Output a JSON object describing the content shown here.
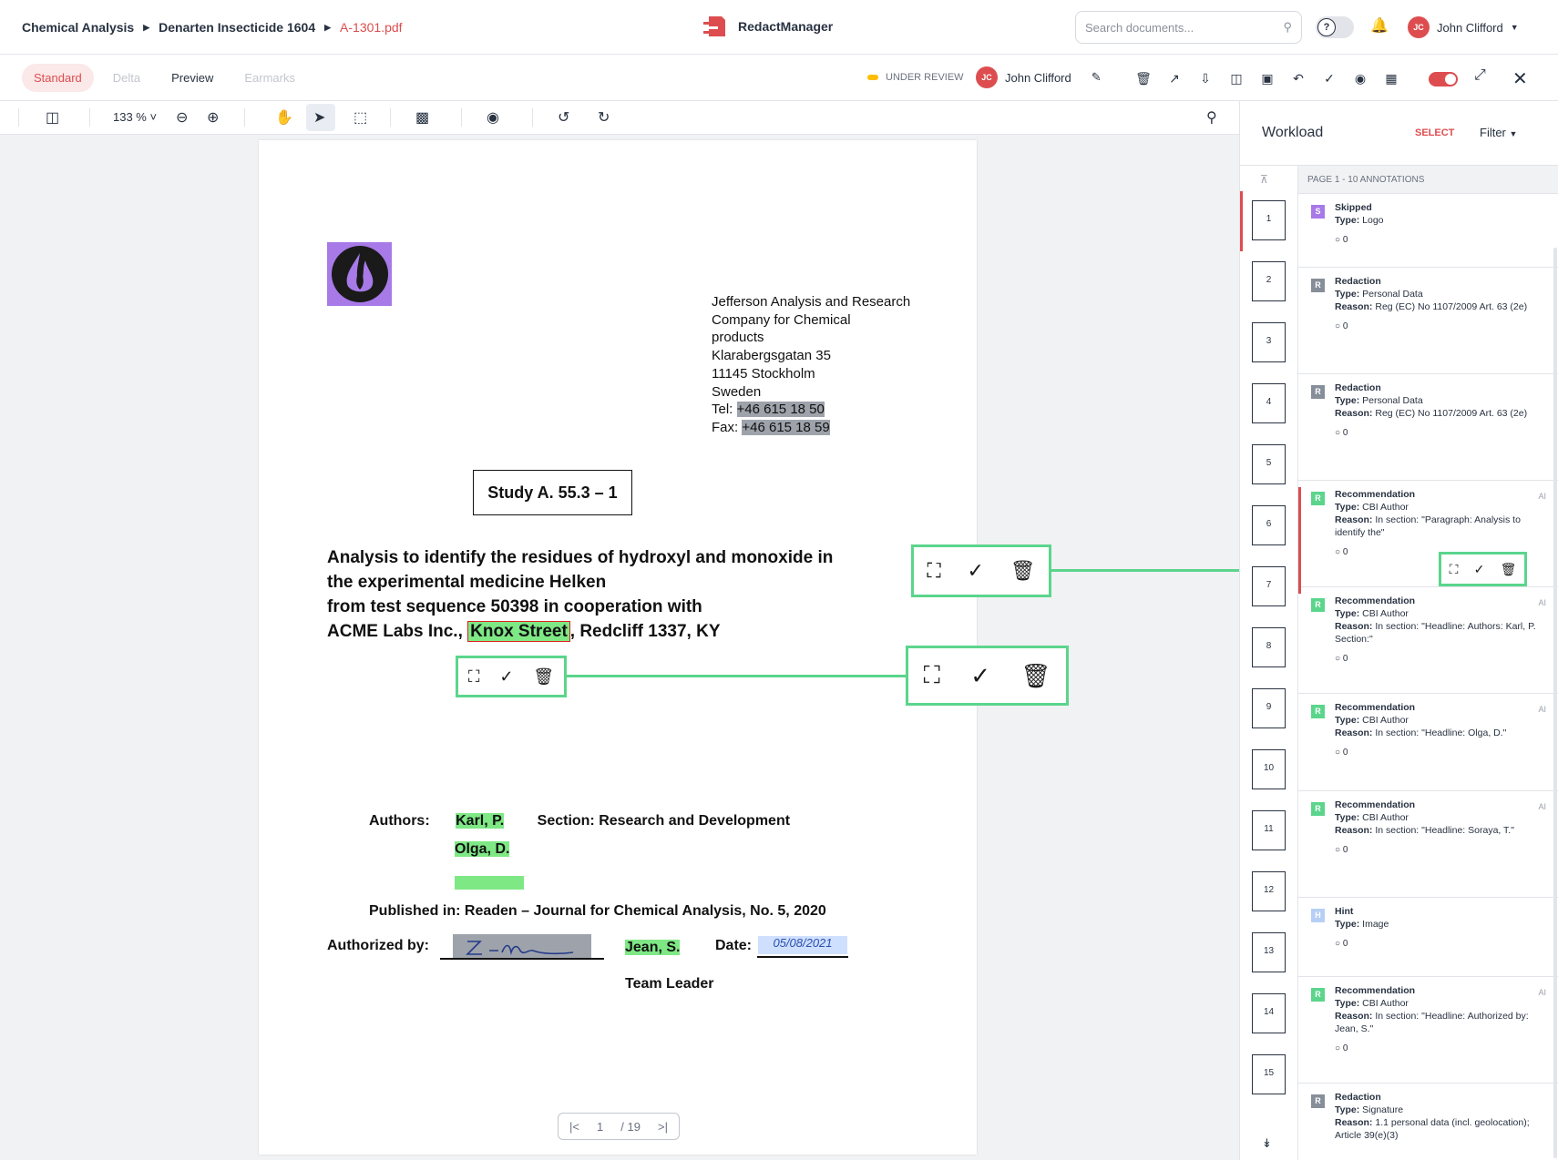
{
  "breadcrumb": {
    "items": [
      "Chemical Analysis",
      "Denarten Insecticide 1604",
      "A-1301.pdf"
    ]
  },
  "app": {
    "name": "RedactManager"
  },
  "search": {
    "placeholder": "Search documents..."
  },
  "help_toggle": {
    "label": "?"
  },
  "user": {
    "name": "John Clifford",
    "initials": "JC"
  },
  "view_tabs": [
    "Standard",
    "Delta",
    "Preview",
    "Earmarks"
  ],
  "status": {
    "label": "UNDER REVIEW",
    "color": "#fdbd00"
  },
  "assignee": {
    "name": "John Clifford",
    "initials": "JC"
  },
  "toolbar": {
    "zoom": "133 %"
  },
  "document": {
    "address": [
      "Jefferson Analysis and Research",
      "Company for Chemical",
      "products",
      "Klarabergsgatan 35",
      "11145 Stockholm",
      "Sweden"
    ],
    "tel_label": "Tel:",
    "tel": "+46 615 18 50",
    "fax_label": "Fax:",
    "fax": "+46 615 18 59",
    "study": "Study A. 55.3 – 1",
    "headline": [
      "Analysis to identify the residues of hydroxyl and monoxide in",
      "the experimental medicine Helken",
      "from test sequence 50398 in cooperation with"
    ],
    "hl_prefix": "ACME Labs Inc., ",
    "hl_street": "Knox Street",
    "hl_suffix": ", Redcliff 1337, KY",
    "authors_label": "Authors:",
    "author1": "Karl, P.",
    "author2": "Olga, D.",
    "section": "Section: Research and Development",
    "published": "Published in: Readen – Journal for Chemical Analysis, No. 5, 2020",
    "authorized_label": "Authorized by:",
    "authorizer": "Jean, S.",
    "date_label": "Date:",
    "date_value": "05/08/2021",
    "team": "Team Leader"
  },
  "pager": {
    "current": "1",
    "total": "/ 19"
  },
  "sidebar": {
    "title": "Workload",
    "select": "SELECT",
    "filter": "Filter",
    "list_header": "PAGE 1 - 10 ANNOTATIONS",
    "thumbs": [
      "1",
      "2",
      "3",
      "4",
      "5",
      "6",
      "7",
      "8",
      "9",
      "10",
      "11",
      "12",
      "13",
      "14",
      "15"
    ],
    "annotations": [
      {
        "badge": "S",
        "color": "#a77ae8",
        "title": "Skipped",
        "type_label": "Type:",
        "type": "Logo",
        "reason": "",
        "comments": "0",
        "ai": ""
      },
      {
        "badge": "R",
        "color": "#868e99",
        "title": "Redaction",
        "type_label": "Type:",
        "type": "Personal Data",
        "reason_label": "Reason:",
        "reason": "Reg (EC) No 1107/2009 Art. 63 (2e)",
        "comments": "0",
        "ai": ""
      },
      {
        "badge": "R",
        "color": "#868e99",
        "title": "Redaction",
        "type_label": "Type:",
        "type": "Personal Data",
        "reason_label": "Reason:",
        "reason": "Reg (EC) No 1107/2009 Art. 63 (2e)",
        "comments": "0",
        "ai": ""
      },
      {
        "badge": "R",
        "color": "#5bd58c",
        "title": "Recommendation",
        "type_label": "Type:",
        "type": "CBI Author",
        "reason_label": "Reason:",
        "reason": "In section: \"Paragraph: Analysis to identify the\"",
        "comments": "0",
        "ai": "AI"
      },
      {
        "badge": "R",
        "color": "#5bd58c",
        "title": "Recommendation",
        "type_label": "Type:",
        "type": "CBI Author",
        "reason_label": "Reason:",
        "reason": "In section: \"Headline: Authors: Karl, P. Section:\"",
        "comments": "0",
        "ai": "AI"
      },
      {
        "badge": "R",
        "color": "#5bd58c",
        "title": "Recommendation",
        "type_label": "Type:",
        "type": "CBI Author",
        "reason_label": "Reason:",
        "reason": "In section: \"Headline: Olga, D.\"",
        "comments": "0",
        "ai": "AI"
      },
      {
        "badge": "R",
        "color": "#5bd58c",
        "title": "Recommendation",
        "type_label": "Type:",
        "type": "CBI Author",
        "reason_label": "Reason:",
        "reason": "In section: \"Headline: Soraya, T.\"",
        "comments": "0",
        "ai": "AI"
      },
      {
        "badge": "H",
        "color": "#b8cff5",
        "title": "Hint",
        "type_label": "Type:",
        "type": "Image",
        "reason": "",
        "comments": "0",
        "ai": ""
      },
      {
        "badge": "R",
        "color": "#5bd58c",
        "title": "Recommendation",
        "type_label": "Type:",
        "type": "CBI Author",
        "reason_label": "Reason:",
        "reason": "In section: \"Headline: Authorized by: Jean, S.\"",
        "comments": "0",
        "ai": "AI"
      },
      {
        "badge": "R",
        "color": "#868e99",
        "title": "Redaction",
        "type_label": "Type:",
        "type": "Signature",
        "reason_label": "Reason:",
        "reason": "1.1 personal data (incl. geolocation); Article 39(e)(3)",
        "comments": "",
        "ai": ""
      }
    ]
  }
}
